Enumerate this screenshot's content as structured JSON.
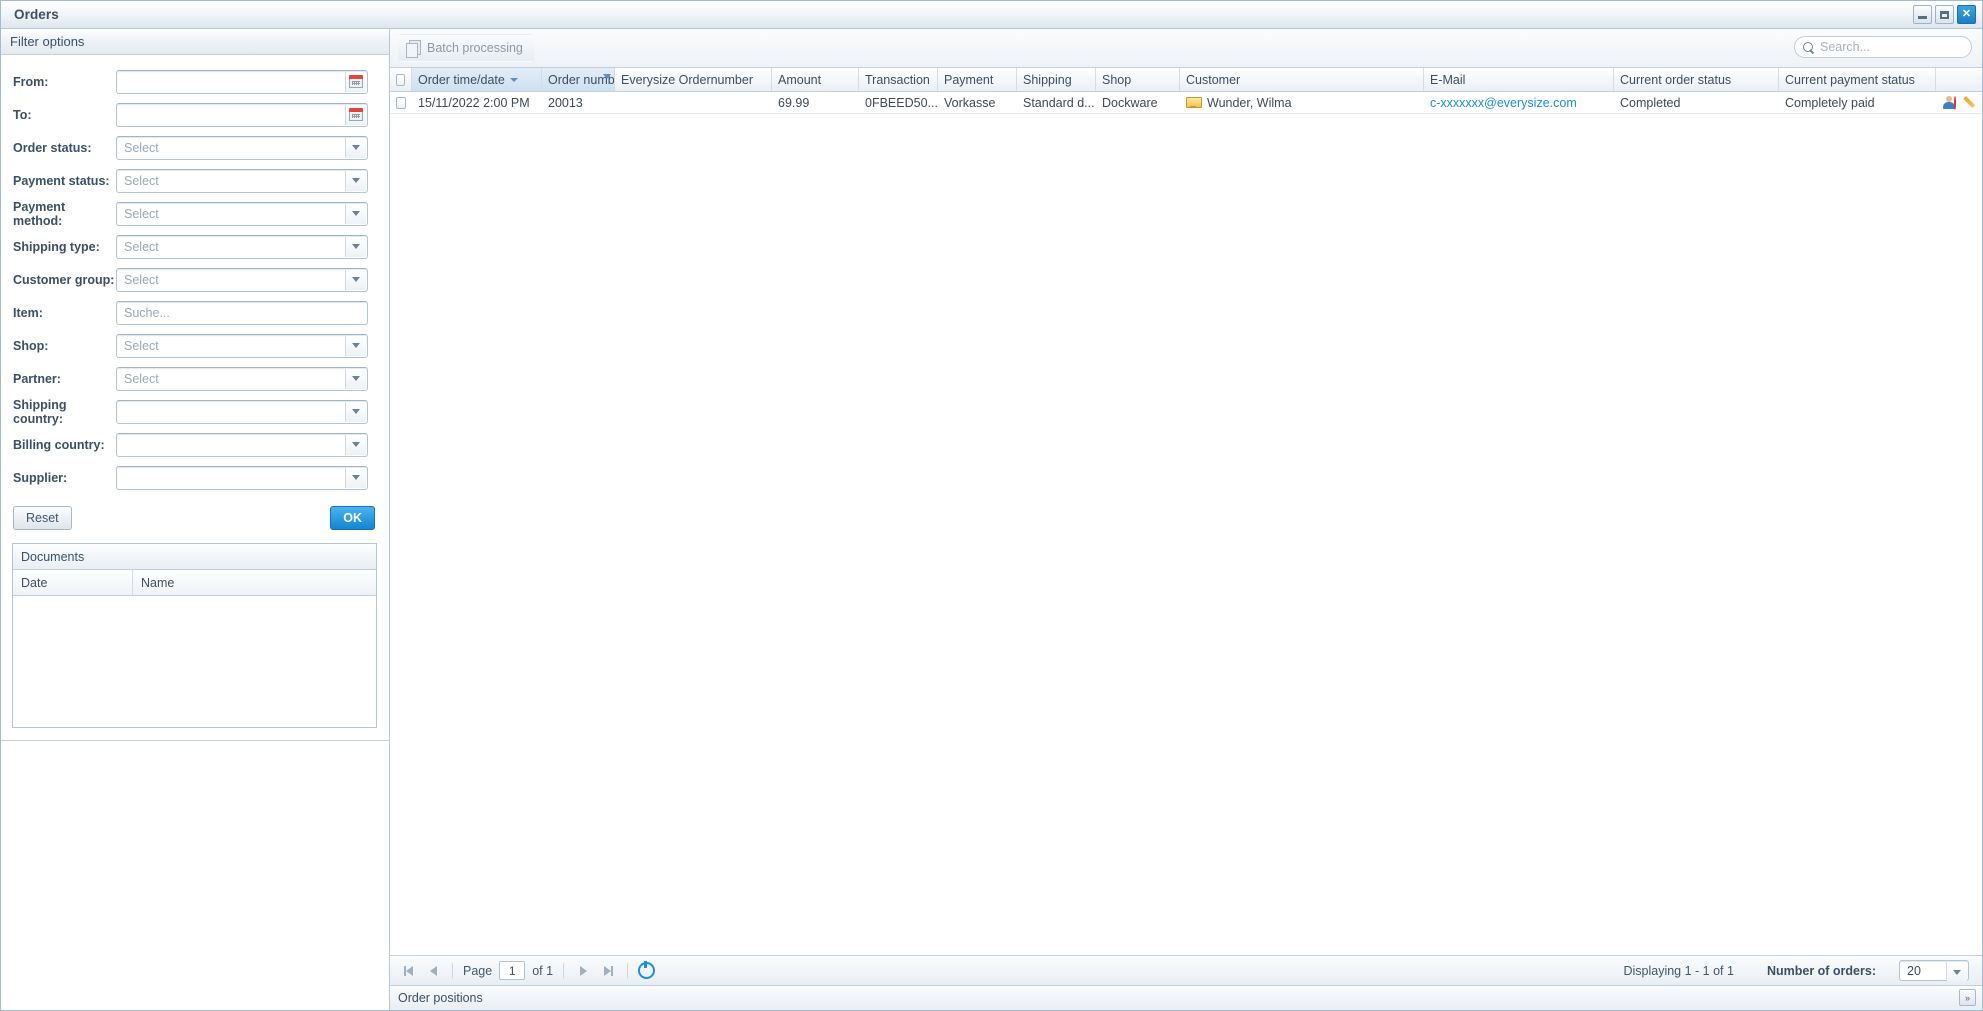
{
  "window": {
    "title": "Orders",
    "controls": [
      {
        "name": "minimize",
        "glyph": "—"
      },
      {
        "name": "maximize",
        "glyph": "□"
      },
      {
        "name": "close",
        "glyph": "✕"
      }
    ]
  },
  "filter_panel": {
    "header": "Filter options",
    "fields": [
      {
        "label": "From:",
        "type": "date",
        "value": "",
        "placeholder": ""
      },
      {
        "label": "To:",
        "type": "date",
        "value": "",
        "placeholder": ""
      },
      {
        "label": "Order status:",
        "type": "select",
        "value": "",
        "placeholder": "Select"
      },
      {
        "label": "Payment status:",
        "type": "select",
        "value": "",
        "placeholder": "Select"
      },
      {
        "label": "Payment method:",
        "type": "select",
        "value": "",
        "placeholder": "Select"
      },
      {
        "label": "Shipping type:",
        "type": "select",
        "value": "",
        "placeholder": "Select"
      },
      {
        "label": "Customer group:",
        "type": "select",
        "value": "",
        "placeholder": "Select"
      },
      {
        "label": "Item:",
        "type": "text",
        "value": "",
        "placeholder": "Suche..."
      },
      {
        "label": "Shop:",
        "type": "select",
        "value": "",
        "placeholder": "Select"
      },
      {
        "label": "Partner:",
        "type": "select",
        "value": "",
        "placeholder": "Select"
      },
      {
        "label": "Shipping country:",
        "type": "select",
        "value": "",
        "placeholder": ""
      },
      {
        "label": "Billing country:",
        "type": "select",
        "value": "",
        "placeholder": ""
      },
      {
        "label": "Supplier:",
        "type": "select",
        "value": "",
        "placeholder": ""
      }
    ],
    "reset_label": "Reset",
    "ok_label": "OK",
    "documents": {
      "title": "Documents",
      "columns": [
        "Date",
        "Name"
      ],
      "rows": []
    }
  },
  "toolbar": {
    "batch_label": "Batch processing",
    "search_placeholder": "Search...",
    "search_value": ""
  },
  "grid": {
    "columns": [
      {
        "key": "checkbox",
        "label": "",
        "sorted": false,
        "menu": false
      },
      {
        "key": "order_time",
        "label": "Order time/date",
        "sorted": true,
        "menu": false
      },
      {
        "key": "order_number",
        "label": "Order numb",
        "sorted": false,
        "menu": true
      },
      {
        "key": "everysize_ordernumber",
        "label": "Everysize Ordernumber",
        "sorted": false,
        "menu": false
      },
      {
        "key": "amount",
        "label": "Amount",
        "sorted": false,
        "menu": false
      },
      {
        "key": "transaction",
        "label": "Transaction",
        "sorted": false,
        "menu": false
      },
      {
        "key": "payment",
        "label": "Payment",
        "sorted": false,
        "menu": false
      },
      {
        "key": "shipping",
        "label": "Shipping",
        "sorted": false,
        "menu": false
      },
      {
        "key": "shop",
        "label": "Shop",
        "sorted": false,
        "menu": false
      },
      {
        "key": "customer",
        "label": "Customer",
        "sorted": false,
        "menu": false
      },
      {
        "key": "email",
        "label": "E-Mail",
        "sorted": false,
        "menu": false
      },
      {
        "key": "order_status",
        "label": "Current order status",
        "sorted": false,
        "menu": false
      },
      {
        "key": "payment_status",
        "label": "Current payment status",
        "sorted": false,
        "menu": false
      },
      {
        "key": "actions",
        "label": "",
        "sorted": false,
        "menu": false
      }
    ],
    "rows": [
      {
        "order_time": "15/11/2022 2:00 PM",
        "order_number": "20013",
        "everysize_ordernumber": "",
        "amount": "69.99",
        "transaction": "0FBEED50...",
        "payment": "Vorkasse",
        "shipping": "Standard d...",
        "shop": "Dockware",
        "customer": "Wunder, Wilma",
        "email": "c-xxxxxxx@everysize.com",
        "order_status": "Completed",
        "payment_status": "Completely paid"
      }
    ]
  },
  "pager": {
    "page_label": "Page",
    "page_value": "1",
    "of_label": "of 1",
    "displaying": "Displaying 1 - 1 of 1",
    "number_of_orders_label": "Number of orders:",
    "number_of_orders_value": "20"
  },
  "status": {
    "order_positions_label": "Order positions",
    "collapse_glyph": "»"
  },
  "colors": {
    "accent": "#1a8fe0",
    "link": "#1a8fe0",
    "header_text": "#3c4f63",
    "delete": "#d93a3a",
    "edit": "#f0a92a"
  }
}
